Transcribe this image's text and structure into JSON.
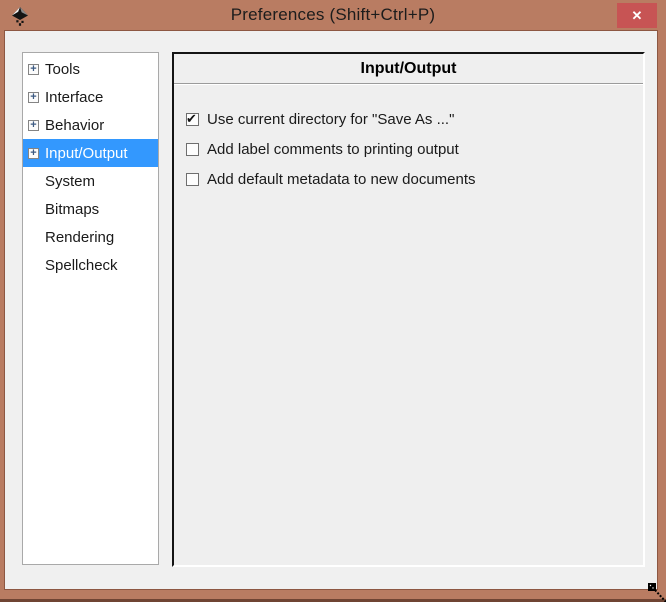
{
  "window": {
    "title": "Preferences (Shift+Ctrl+P)"
  },
  "titlebar": {
    "close_glyph": "✕"
  },
  "icons": {
    "app": "inkscape-logo-icon",
    "close": "close-icon",
    "tree_expander": "plus-box-expander-icon",
    "pointer": "resize-grip-cursor"
  },
  "sidebar": {
    "items": [
      {
        "label": "Tools",
        "expandable": true,
        "selected": false
      },
      {
        "label": "Interface",
        "expandable": true,
        "selected": false
      },
      {
        "label": "Behavior",
        "expandable": true,
        "selected": false
      },
      {
        "label": "Input/Output",
        "expandable": true,
        "selected": true
      },
      {
        "label": "System",
        "expandable": false,
        "selected": false
      },
      {
        "label": "Bitmaps",
        "expandable": false,
        "selected": false
      },
      {
        "label": "Rendering",
        "expandable": false,
        "selected": false
      },
      {
        "label": "Spellcheck",
        "expandable": false,
        "selected": false
      }
    ]
  },
  "main": {
    "header": "Input/Output",
    "options": [
      {
        "label": "Use current directory for \"Save As ...\"",
        "checked": true
      },
      {
        "label": "Add label comments to printing output",
        "checked": false
      },
      {
        "label": "Add default metadata to new documents",
        "checked": false
      }
    ]
  },
  "colors": {
    "titlebar_bg": "#b97c62",
    "close_button_bg": "#c75454",
    "selection_blue": "#3398fe",
    "dialog_bg": "#f0f0f0",
    "panel_bg": "#ffffff",
    "main_border_dark": "#141414",
    "frame_dark_edge": "#6f4433"
  }
}
